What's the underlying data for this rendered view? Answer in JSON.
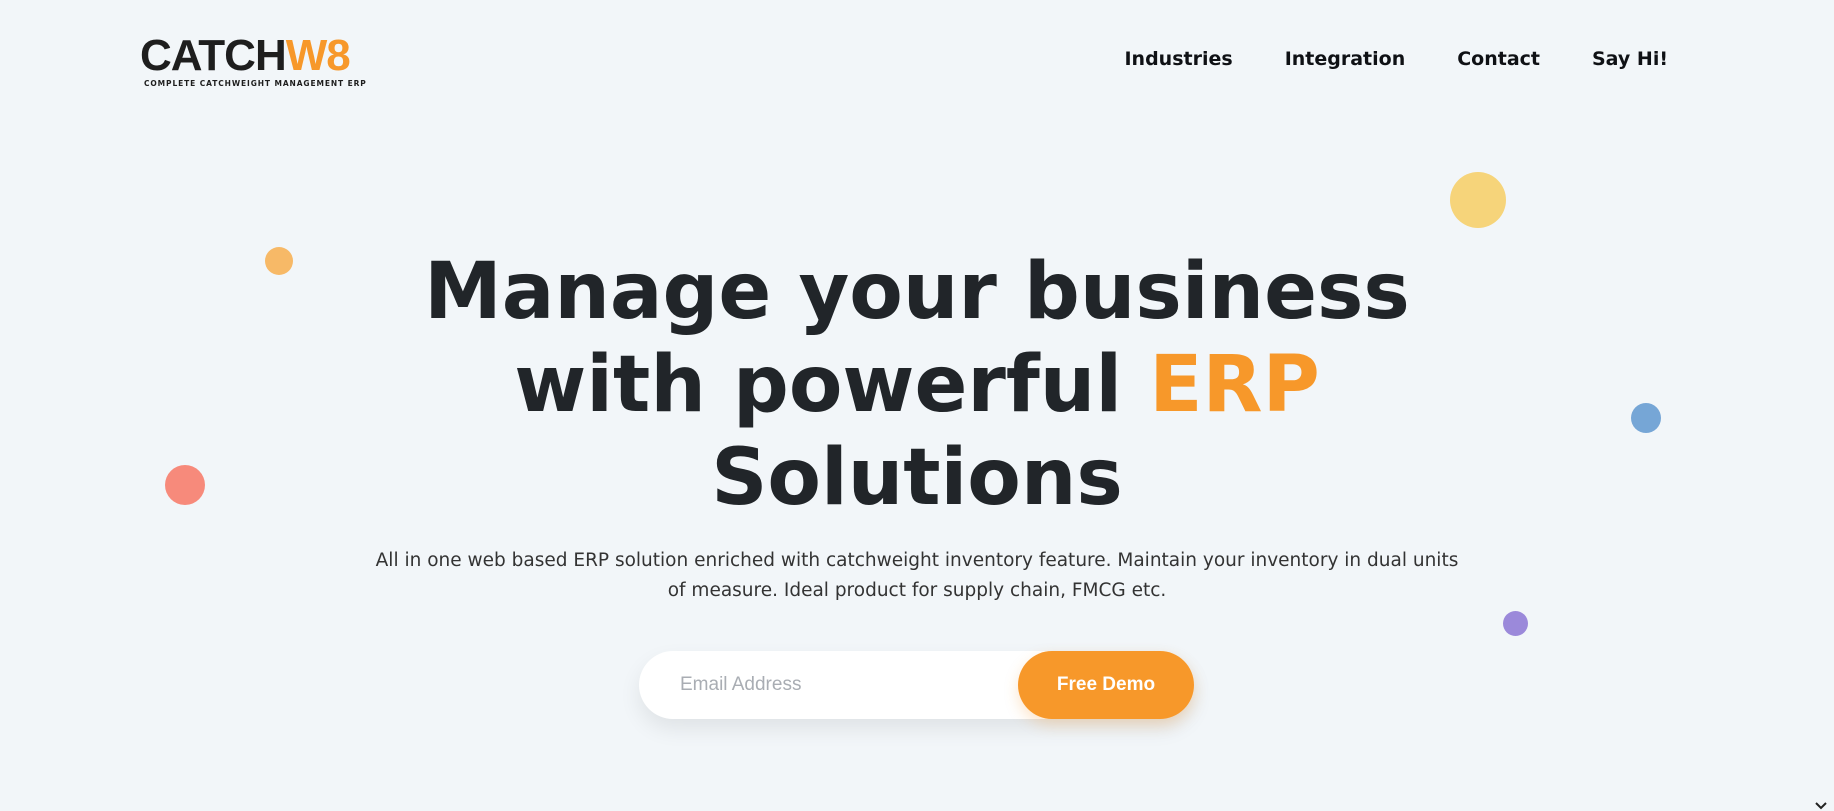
{
  "brand": {
    "name_main": "CATCH",
    "name_accent": "W8",
    "tagline": "COMPLETE CATCHWEIGHT MANAGEMENT ERP"
  },
  "nav": {
    "items": [
      {
        "label": "Industries"
      },
      {
        "label": "Integration"
      },
      {
        "label": "Contact"
      },
      {
        "label": "Say Hi!"
      }
    ]
  },
  "hero": {
    "title_line1": "Manage your business",
    "title_line2_prefix": "with powerful ",
    "title_line2_accent": "ERP",
    "title_line3": "Solutions",
    "subtitle": "All in one web based ERP solution enriched with catchweight inventory feature. Maintain your inventory in dual units of measure. Ideal product for supply chain, FMCG etc."
  },
  "form": {
    "email_placeholder": "Email Address",
    "email_value": "",
    "submit_label": "Free Demo"
  },
  "colors": {
    "accent": "#f7982a",
    "background": "#f2f6f9",
    "text": "#212529"
  },
  "icons": {
    "scroll": "chevron-down-icon"
  }
}
